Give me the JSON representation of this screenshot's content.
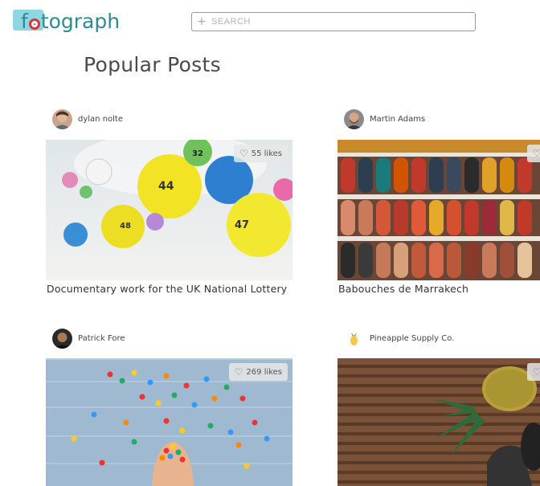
{
  "app": {
    "logo_text": "fotograph",
    "colors": {
      "logo_teal": "#2d8c8f",
      "logo_red": "#d9353a",
      "logo_bg": "#8fd6e4"
    }
  },
  "search": {
    "placeholder": "SEARCH",
    "icon": "plus-icon"
  },
  "page": {
    "title": "Popular Posts"
  },
  "posts": [
    {
      "author": "dylan nolte",
      "likes": "55 likes",
      "caption": "Documentary work for the UK National Lottery"
    },
    {
      "author": "Martin Adams",
      "likes": "",
      "caption": "Babouches de Marrakech"
    },
    {
      "author": "Patrick Fore",
      "likes": "269 likes",
      "caption": ""
    },
    {
      "author": "Pineapple Supply Co.",
      "likes": "",
      "caption": ""
    }
  ]
}
